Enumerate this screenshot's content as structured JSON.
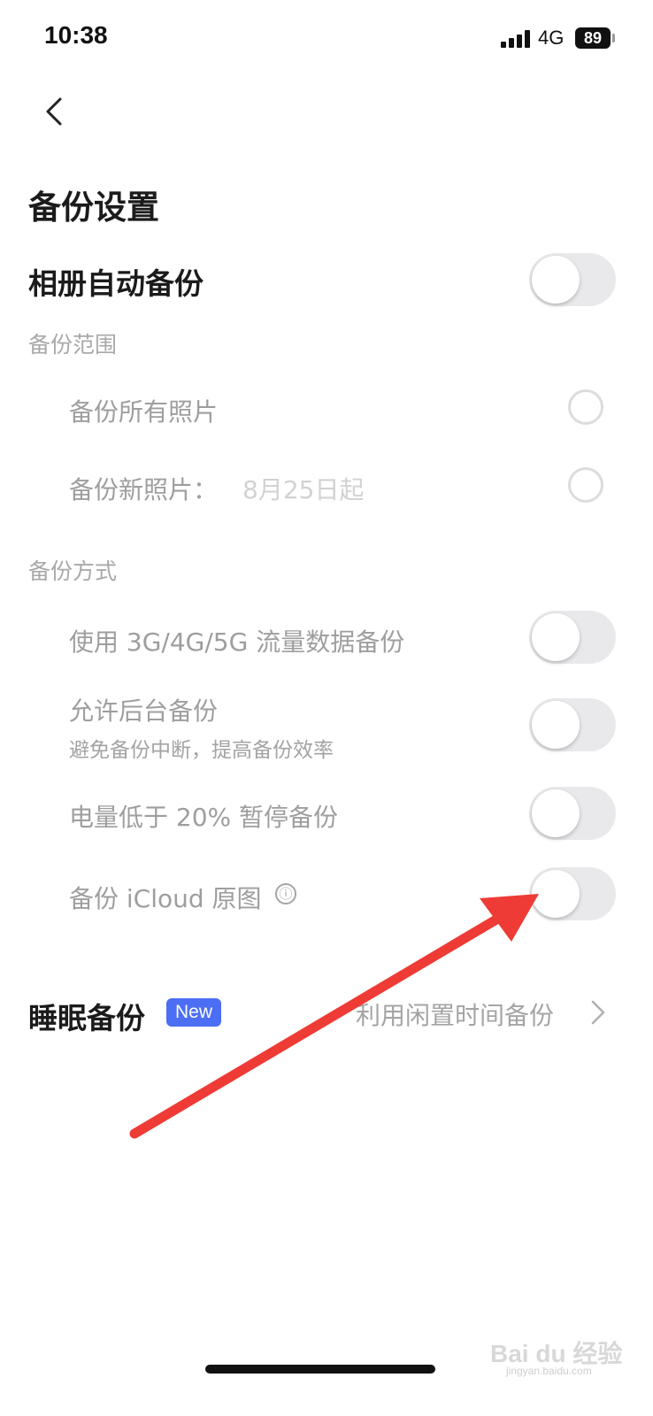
{
  "status_bar": {
    "time": "10:38",
    "network": "4G",
    "battery": "89"
  },
  "nav": {
    "back_icon": "chevron-left-icon"
  },
  "page_title": "备份设置",
  "album_auto_backup": {
    "label": "相册自动备份",
    "enabled": false
  },
  "backup_scope": {
    "section_label": "备份范围",
    "options": [
      {
        "label": "备份所有照片",
        "hint": "",
        "selected": false
      },
      {
        "label": "备份新照片：",
        "hint": "8月25日起",
        "selected": false
      }
    ]
  },
  "backup_method": {
    "section_label": "备份方式",
    "options": [
      {
        "label": "使用 3G/4G/5G 流量数据备份",
        "sub": "",
        "enabled": false
      },
      {
        "label": "允许后台备份",
        "sub": "避免备份中断，提高备份效率",
        "enabled": false
      },
      {
        "label": "电量低于 20% 暂停备份",
        "sub": "",
        "enabled": false
      },
      {
        "label": "备份 iCloud 原图",
        "sub": "",
        "enabled": false,
        "info_icon": "ⓘ"
      }
    ]
  },
  "sleep_backup": {
    "label": "睡眠备份",
    "badge": "New",
    "description": "利用闲置时间备份"
  },
  "colors": {
    "badge": "#4c6ef5",
    "arrow": "#ef3b35",
    "toggle_off": "#e9e9eb"
  },
  "watermark": {
    "brand": "Bai du 经验",
    "url": "jingyan.baidu.com"
  }
}
